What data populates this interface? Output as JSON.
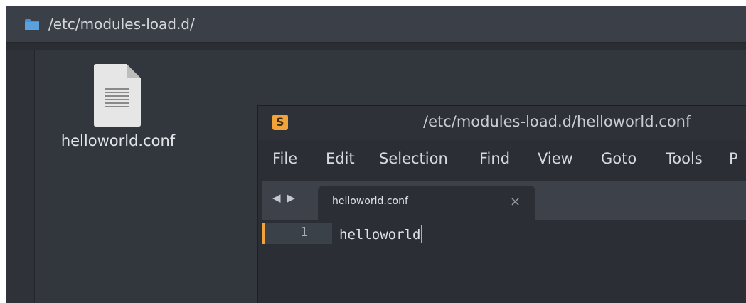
{
  "file_manager": {
    "path": "/etc/modules-load.d/",
    "folder_icon": "folder-icon",
    "items": [
      {
        "name": "helloworld.conf",
        "icon": "text-file-icon"
      }
    ]
  },
  "editor": {
    "app_logo": "S",
    "window_title": "/etc/modules-load.d/helloworld.conf",
    "menu": [
      "File",
      "Edit",
      "Selection",
      "Find",
      "View",
      "Goto",
      "Tools",
      "P"
    ],
    "nav_arrows": "◀ ▶",
    "tab": {
      "label": "helloworld.conf",
      "close": "×"
    },
    "lines": [
      {
        "number": "1",
        "text": "helloworld"
      }
    ],
    "accent_color": "#f2a33a"
  }
}
